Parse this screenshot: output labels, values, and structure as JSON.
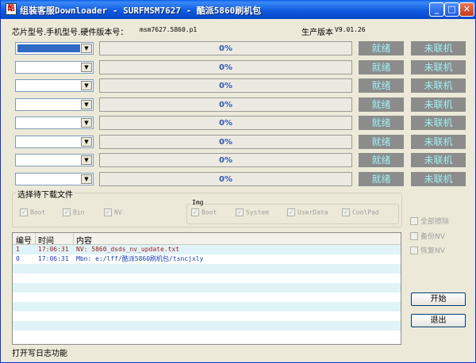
{
  "window": {
    "title": "组装客服Downloader - SURFMSM7627 - 酷派5860刷机包",
    "icon_text": "酷",
    "controls": {
      "minimize": "_",
      "maximize": "□",
      "close": "✕"
    }
  },
  "info": {
    "chip_label": "芯片型号.手机型号.硬件版本号：",
    "chip_value": "msm7627.5860.p1",
    "version_label": "生产版本",
    "version_value": "V9.01.26"
  },
  "ports": [
    {
      "progress": "0%",
      "progress_value": 0,
      "status1": "就绪",
      "status2": "未联机",
      "selected": true
    },
    {
      "progress": "0%",
      "progress_value": 0,
      "status1": "就绪",
      "status2": "未联机",
      "selected": false
    },
    {
      "progress": "0%",
      "progress_value": 0,
      "status1": "就绪",
      "status2": "未联机",
      "selected": false
    },
    {
      "progress": "0%",
      "progress_value": 0,
      "status1": "就绪",
      "status2": "未联机",
      "selected": false
    },
    {
      "progress": "0%",
      "progress_value": 0,
      "status1": "就绪",
      "status2": "未联机",
      "selected": false
    },
    {
      "progress": "0%",
      "progress_value": 0,
      "status1": "就绪",
      "status2": "未联机",
      "selected": false
    },
    {
      "progress": "0%",
      "progress_value": 0,
      "status1": "就绪",
      "status2": "未联机",
      "selected": false
    },
    {
      "progress": "0%",
      "progress_value": 0,
      "status1": "就绪",
      "status2": "未联机",
      "selected": false
    }
  ],
  "files": {
    "legend": "选择待下载文件",
    "items": [
      {
        "label": "Boot",
        "checked": true
      },
      {
        "label": "Bin",
        "checked": true
      },
      {
        "label": "NV",
        "checked": true
      }
    ],
    "img": {
      "legend": "Img",
      "items": [
        {
          "label": "Boot",
          "checked": true
        },
        {
          "label": "System",
          "checked": true
        },
        {
          "label": "UserData",
          "checked": true
        },
        {
          "label": "CoolPad",
          "checked": true
        }
      ]
    }
  },
  "options": [
    {
      "label": "全部擦除",
      "checked": false
    },
    {
      "label": "备份NV",
      "checked": false
    },
    {
      "label": "恢复NV",
      "checked": false
    }
  ],
  "log": {
    "columns": [
      "编号",
      "时间",
      "内容"
    ],
    "rows": [
      {
        "id": "1",
        "time": "17:06:31",
        "content": "NV: 5860_dsds_nv_update.txt",
        "color": "#9c1a1a"
      },
      {
        "id": "0",
        "time": "17:06:31",
        "content": "Mbn: e:/lff/酷派5860刷机包/tsncjxly",
        "color": "#1a3cb8"
      }
    ]
  },
  "buttons": {
    "start": "开始",
    "exit": "退出"
  },
  "statusbar": "打开写日志功能",
  "colors": {
    "title_bar": "#0747c8",
    "status_bg": "#8c8c8c",
    "status_text": "#9ef0f4",
    "progress_text": "#3158b5"
  }
}
